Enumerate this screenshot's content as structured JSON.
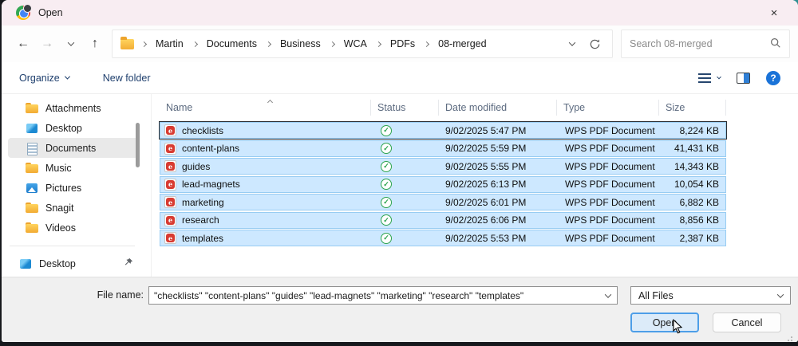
{
  "window": {
    "title": "Open",
    "close_glyph": "×"
  },
  "nav": {
    "back_glyph": "←",
    "forward_glyph": "→",
    "up_glyph": "↑",
    "breadcrumb": [
      "Martin",
      "Documents",
      "Business",
      "WCA",
      "PDFs",
      "08-merged"
    ],
    "search_placeholder": "Search 08-merged"
  },
  "toolbar": {
    "organize_label": "Organize",
    "new_folder_label": "New folder",
    "help_glyph": "?"
  },
  "sidebar": {
    "items": [
      {
        "label": "Attachments",
        "icon": "folder-icon"
      },
      {
        "label": "Desktop",
        "icon": "desktop-icon"
      },
      {
        "label": "Documents",
        "icon": "documents-icon",
        "selected": true
      },
      {
        "label": "Music",
        "icon": "folder-icon"
      },
      {
        "label": "Pictures",
        "icon": "pictures-icon"
      },
      {
        "label": "Snagit",
        "icon": "folder-icon"
      },
      {
        "label": "Videos",
        "icon": "folder-icon"
      }
    ],
    "pinned_item": {
      "label": "Desktop",
      "icon": "desktop-icon"
    }
  },
  "list": {
    "columns": [
      "Name",
      "Status",
      "Date modified",
      "Type",
      "Size"
    ],
    "rows": [
      {
        "name": "checklists",
        "date_modified": "9/02/2025 5:47 PM",
        "type": "WPS PDF Document",
        "size": "8,224 KB"
      },
      {
        "name": "content-plans",
        "date_modified": "9/02/2025 5:59 PM",
        "type": "WPS PDF Document",
        "size": "41,431 KB"
      },
      {
        "name": "guides",
        "date_modified": "9/02/2025 5:55 PM",
        "type": "WPS PDF Document",
        "size": "14,343 KB"
      },
      {
        "name": "lead-magnets",
        "date_modified": "9/02/2025 6:13 PM",
        "type": "WPS PDF Document",
        "size": "10,054 KB"
      },
      {
        "name": "marketing",
        "date_modified": "9/02/2025 6:01 PM",
        "type": "WPS PDF Document",
        "size": "6,882 KB"
      },
      {
        "name": "research",
        "date_modified": "9/02/2025 6:06 PM",
        "type": "WPS PDF Document",
        "size": "8,856 KB"
      },
      {
        "name": "templates",
        "date_modified": "9/02/2025 5:53 PM",
        "type": "WPS PDF Document",
        "size": "2,387 KB"
      }
    ]
  },
  "footer": {
    "file_name_label": "File name:",
    "file_name_value": "\"checklists\" \"content-plans\" \"guides\" \"lead-magnets\" \"marketing\" \"research\" \"templates\"",
    "file_type_value": "All Files",
    "open_label": "Open",
    "cancel_label": "Cancel"
  },
  "colors": {
    "titlebar_pink": "#f8edf2",
    "selection_bg": "#cde8ff",
    "selection_border": "#98ccf2",
    "accent_blue": "#4d9ee8",
    "status_green": "#2da44e",
    "pdf_red": "#d83b31"
  }
}
